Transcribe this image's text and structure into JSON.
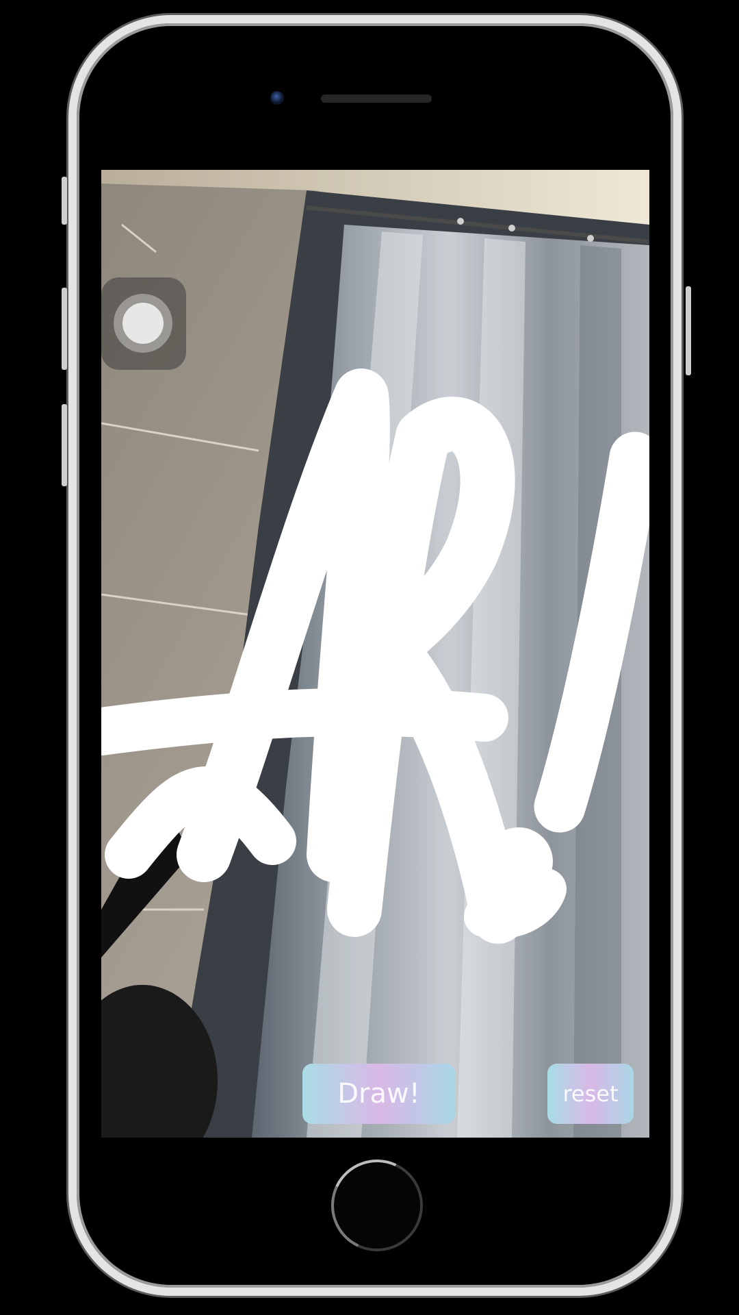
{
  "app": {
    "draw_label": "Draw!",
    "reset_label": "reset",
    "drawn_text": "AR!"
  },
  "icons": {
    "assistive_touch": "assistive-touch-icon",
    "home": "home-button-icon"
  },
  "colors": {
    "button_gradient_start": "#a9dde6",
    "button_gradient_mid": "#d9b8e6",
    "stroke": "#ffffff"
  }
}
